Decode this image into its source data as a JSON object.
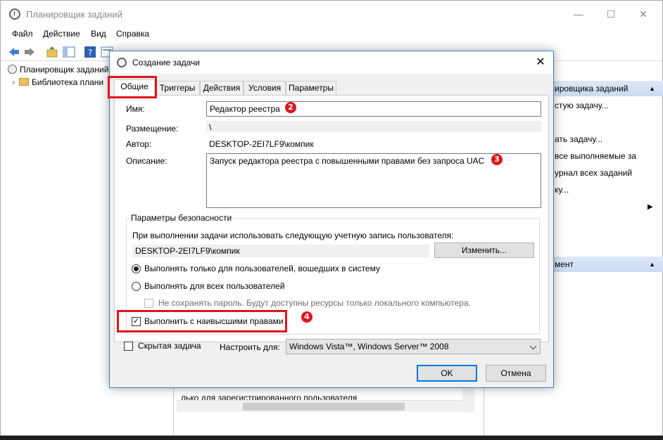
{
  "main_window": {
    "title": "Планировщик заданий",
    "menu": [
      "Файл",
      "Действие",
      "Вид",
      "Справка"
    ],
    "tree": {
      "root": "Планировщик заданий",
      "library": "Библиотека плани"
    },
    "actions": {
      "header1": "ировщика заданий",
      "items": [
        "стую задачу...",
        "ать задачу...",
        "все выполняемые за",
        "урнал всех заданий",
        "ку..."
      ],
      "header2": "мент"
    },
    "middle_bottom_text": "лько для зарегистрированного пользователя"
  },
  "dialog": {
    "title": "Создание задачи",
    "close_glyph": "✕",
    "tabs": [
      "Общие",
      "Триггеры",
      "Действия",
      "Условия",
      "Параметры"
    ],
    "active_tab": "Общие",
    "fields": {
      "name_label": "Имя:",
      "name_value": "Редактор реестра",
      "location_label": "Размещение:",
      "location_value": "\\",
      "author_label": "Автор:",
      "author_value": "DESKTOP-2EI7LF9\\компик",
      "description_label": "Описание:",
      "description_value": "Запуск редактора реестра с повышенными правами без запроса UAC"
    },
    "security": {
      "group_title": "Параметры безопасности",
      "account_prompt": "При выполнении задачи использовать следующую учетную запись пользователя:",
      "account_value": "DESKTOP-2EI7LF9\\компик",
      "change_button": "Изменить...",
      "radio_logged_on": "Выполнять только для пользователей, вошедших в систему",
      "radio_all_users": "Выполнять для всех пользователей",
      "no_store_password": "Не сохранять пароль. Будут доступны ресурсы только локального компьютера.",
      "highest_privileges": "Выполнить с наивысшими правами",
      "highest_privileges_checked": true
    },
    "hidden_task_label": "Скрытая задача",
    "configure_label": "Настроить для:",
    "configure_value": "Windows Vista™, Windows Server™ 2008",
    "ok_button": "OK",
    "cancel_button": "Отмена"
  },
  "annotations": {
    "marker2": "2",
    "marker3": "3",
    "marker4": "4",
    "color": "#e0141e"
  }
}
